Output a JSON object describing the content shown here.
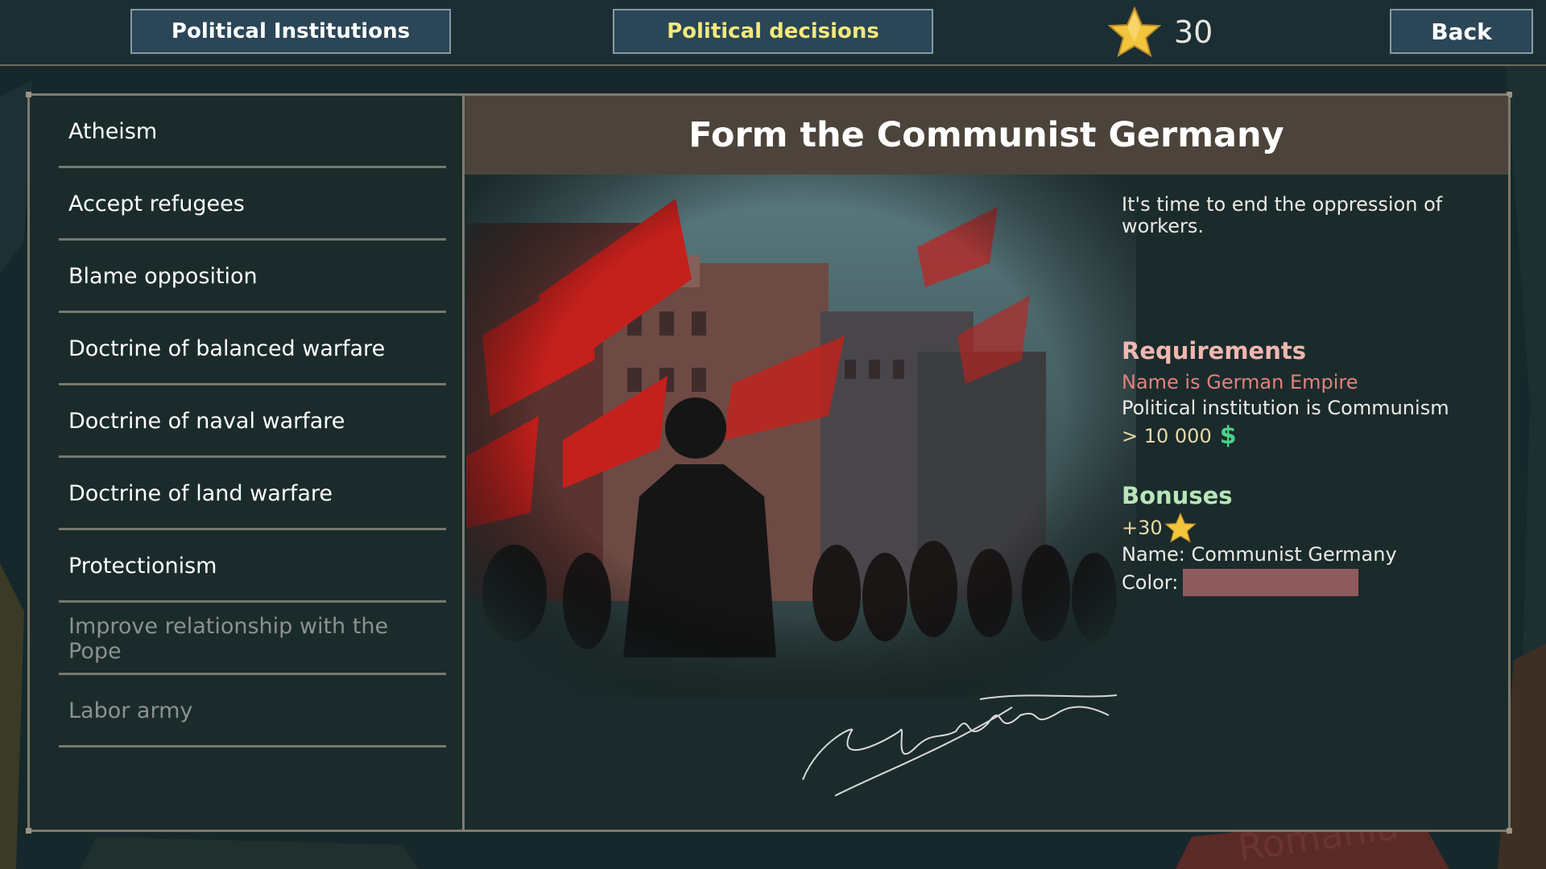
{
  "topbar": {
    "institutions_label": "Political Institutions",
    "decisions_label": "Political decisions",
    "points_value": "30",
    "back_label": "Back"
  },
  "decisions": [
    {
      "label": "Atheism",
      "enabled": true
    },
    {
      "label": "Accept refugees",
      "enabled": true
    },
    {
      "label": "Blame opposition",
      "enabled": true
    },
    {
      "label": "Doctrine of balanced warfare",
      "enabled": true
    },
    {
      "label": "Doctrine of naval warfare",
      "enabled": true
    },
    {
      "label": "Doctrine of land warfare",
      "enabled": true
    },
    {
      "label": "Protectionism",
      "enabled": true
    },
    {
      "label": "Improve relationship with the Pope",
      "enabled": false
    },
    {
      "label": "Labor army",
      "enabled": false
    }
  ],
  "detail": {
    "title": "Form the Communist Germany",
    "description": "It's time to end the oppression of workers.",
    "requirements_title": "Requirements",
    "requirements": [
      "Name is German Empire",
      "Political institution is Communism",
      "> 10 000"
    ],
    "requirement_currency_symbol": "$",
    "bonuses_title": "Bonuses",
    "bonus_points": "+30",
    "bonus_name": "Name: Communist Germany",
    "bonus_color_label": "Color:",
    "bonus_color_value": "#8f5a5e"
  },
  "colors": {
    "active_tab": "#f3e97a",
    "requirement_unmet": "#e0837a",
    "bonus_title": "#b8e6b9",
    "money": "#4dd08a",
    "star": "#f2c53d"
  },
  "icons": {
    "points": "star-icon",
    "money": "dollar-icon"
  }
}
